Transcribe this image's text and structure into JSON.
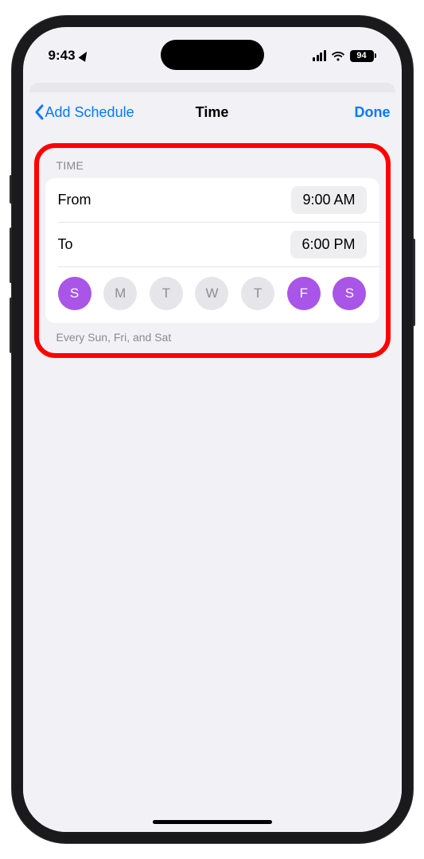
{
  "status": {
    "time": "9:43",
    "battery_pct": "94"
  },
  "nav": {
    "back_label": "Add Schedule",
    "title": "Time",
    "done_label": "Done"
  },
  "section": {
    "header": "TIME",
    "from_label": "From",
    "from_value": "9:00 AM",
    "to_label": "To",
    "to_value": "6:00 PM",
    "days": [
      {
        "letter": "S",
        "active": true
      },
      {
        "letter": "M",
        "active": false
      },
      {
        "letter": "T",
        "active": false
      },
      {
        "letter": "W",
        "active": false
      },
      {
        "letter": "T",
        "active": false
      },
      {
        "letter": "F",
        "active": true
      },
      {
        "letter": "S",
        "active": true
      }
    ],
    "summary": "Every Sun, Fri, and Sat"
  },
  "colors": {
    "accent": "#007aff",
    "day_active": "#a855e8",
    "highlight": "#ff0000"
  }
}
